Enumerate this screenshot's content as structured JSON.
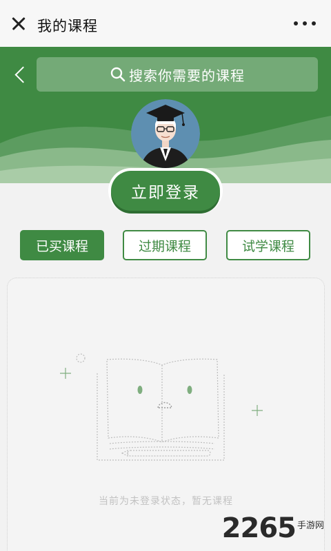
{
  "topbar": {
    "title": "我的课程",
    "close_icon": "close-icon",
    "more_icon": "more-horizontal-icon"
  },
  "header": {
    "back_icon": "chevron-left-icon",
    "search_placeholder": "搜索你需要的课程",
    "search_icon": "search-icon",
    "avatar": "graduate-avatar"
  },
  "login_button": {
    "label": "立即登录"
  },
  "tabs": [
    {
      "label": "已买课程",
      "active": true
    },
    {
      "label": "过期课程",
      "active": false
    },
    {
      "label": "试学课程",
      "active": false
    }
  ],
  "empty_state": {
    "illustration": "empty-book-icon",
    "message": "当前为未登录状态，暂无课程"
  },
  "watermark": {
    "number": "2265",
    "site": "手游网"
  },
  "colors": {
    "brand_green": "#3f8a43",
    "page_bg": "#f2f2f2",
    "muted_text": "#c2c2c2"
  }
}
